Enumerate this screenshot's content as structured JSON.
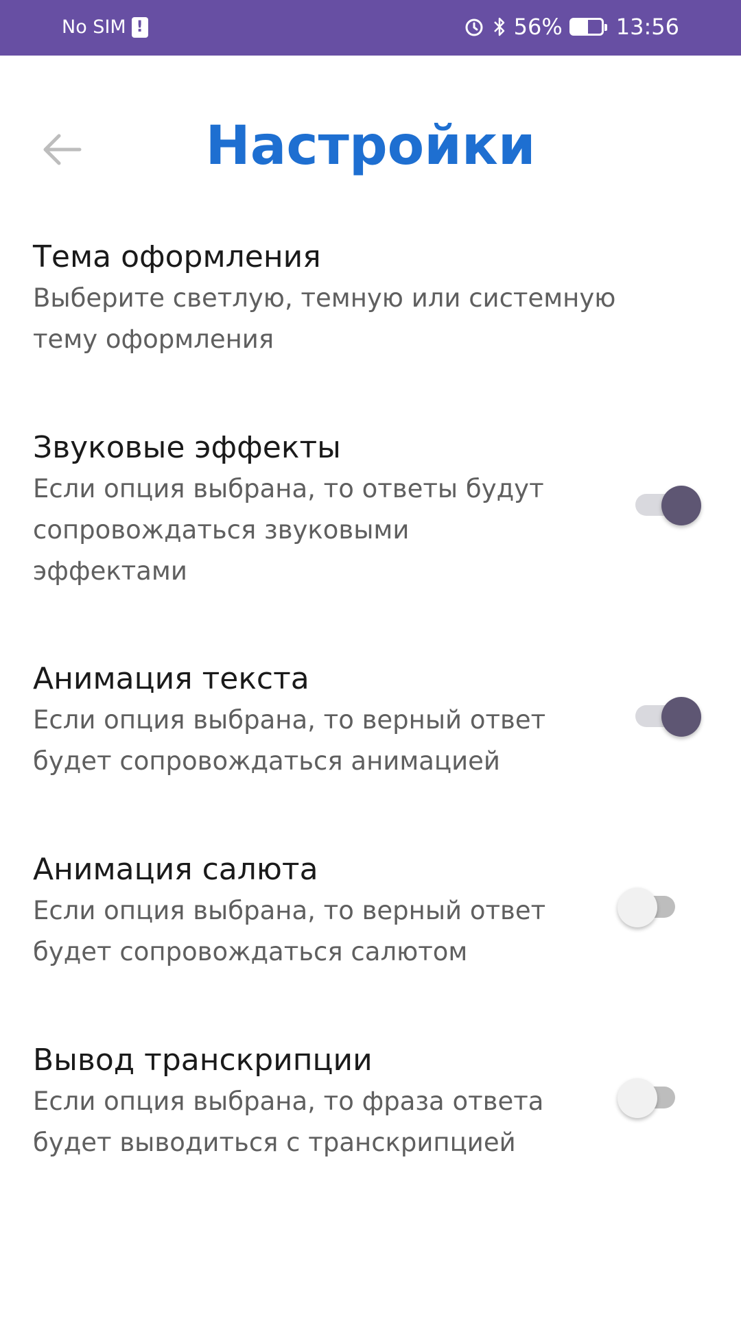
{
  "status_bar": {
    "carrier": "No SIM",
    "sim_alert": "!",
    "battery": "56%",
    "time": "13:56"
  },
  "header": {
    "title": "Настройки"
  },
  "settings": [
    {
      "title": "Тема оформления",
      "description": "Выберите светлую, темную или системную тему оформления"
    },
    {
      "title": "Звуковые эффекты",
      "description": "Если опция выбрана, то ответы будут сопровождаться звуковыми эффектами",
      "enabled": true
    },
    {
      "title": "Анимация текста",
      "description": "Если опция выбрана, то верный ответ будет сопровождаться анимацией",
      "enabled": true
    },
    {
      "title": "Анимация салюта",
      "description": "Если опция выбрана, то верный ответ будет сопровождаться салютом",
      "enabled": false
    },
    {
      "title": "Вывод транскрипции",
      "description": "Если опция выбрана, то фраза ответа будет выводиться с транскрипцией",
      "enabled": false
    }
  ],
  "colors": {
    "status_bar": "#674fa3",
    "title": "#1e6fd1",
    "toggle_on_knob": "#5e5673",
    "toggle_off_knob": "#f1f1f1"
  },
  "icons": {
    "back": "arrow-left-icon",
    "alarm": "alarm-icon",
    "bluetooth": "bluetooth-icon",
    "battery": "battery-charging-icon"
  }
}
